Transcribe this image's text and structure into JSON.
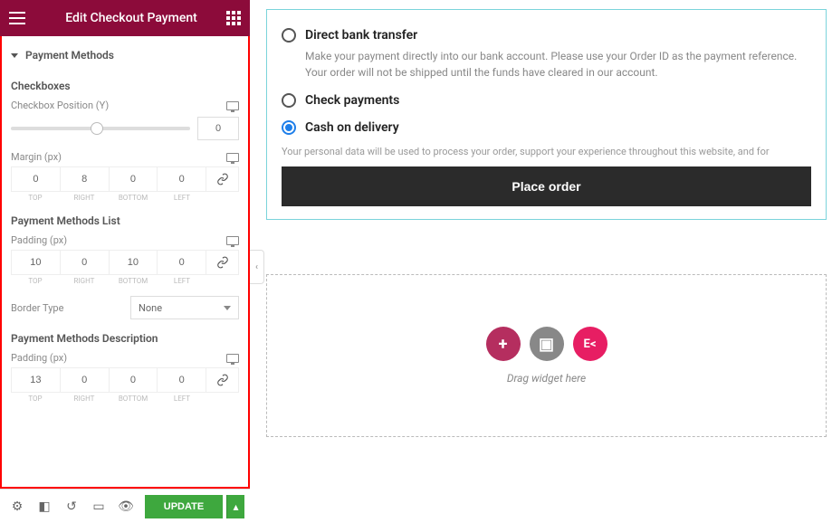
{
  "sidebar": {
    "title": "Edit Checkout Payment",
    "section": "Payment Methods",
    "groups": {
      "checkboxes": {
        "title": "Checkboxes",
        "position_y_label": "Checkbox Position (Y)",
        "position_y_value": "0",
        "margin_label": "Margin (px)",
        "margin": {
          "top": "0",
          "right": "8",
          "bottom": "0",
          "left": "0"
        }
      },
      "list": {
        "title": "Payment Methods List",
        "padding_label": "Padding (px)",
        "padding": {
          "top": "10",
          "right": "0",
          "bottom": "10",
          "left": "0"
        },
        "border_type_label": "Border Type",
        "border_type_value": "None"
      },
      "description": {
        "title": "Payment Methods Description",
        "padding_label": "Padding (px)",
        "padding": {
          "top": "13",
          "right": "0",
          "bottom": "0",
          "left": "0"
        }
      }
    },
    "dim_labels": {
      "top": "TOP",
      "right": "RIGHT",
      "bottom": "BOTTOM",
      "left": "LEFT"
    },
    "update_label": "UPDATE"
  },
  "preview": {
    "options": {
      "bank": {
        "label": "Direct bank transfer",
        "desc": "Make your payment directly into our bank account. Please use your Order ID as the payment reference. Your order will not be shipped until the funds have cleared in our account."
      },
      "check": {
        "label": "Check payments"
      },
      "cod": {
        "label": "Cash on delivery"
      }
    },
    "privacy": "Your personal data will be used to process your order, support your experience throughout this website, and for",
    "place_order": "Place order",
    "drop_text": "Drag widget here",
    "ek_label": "E<"
  }
}
